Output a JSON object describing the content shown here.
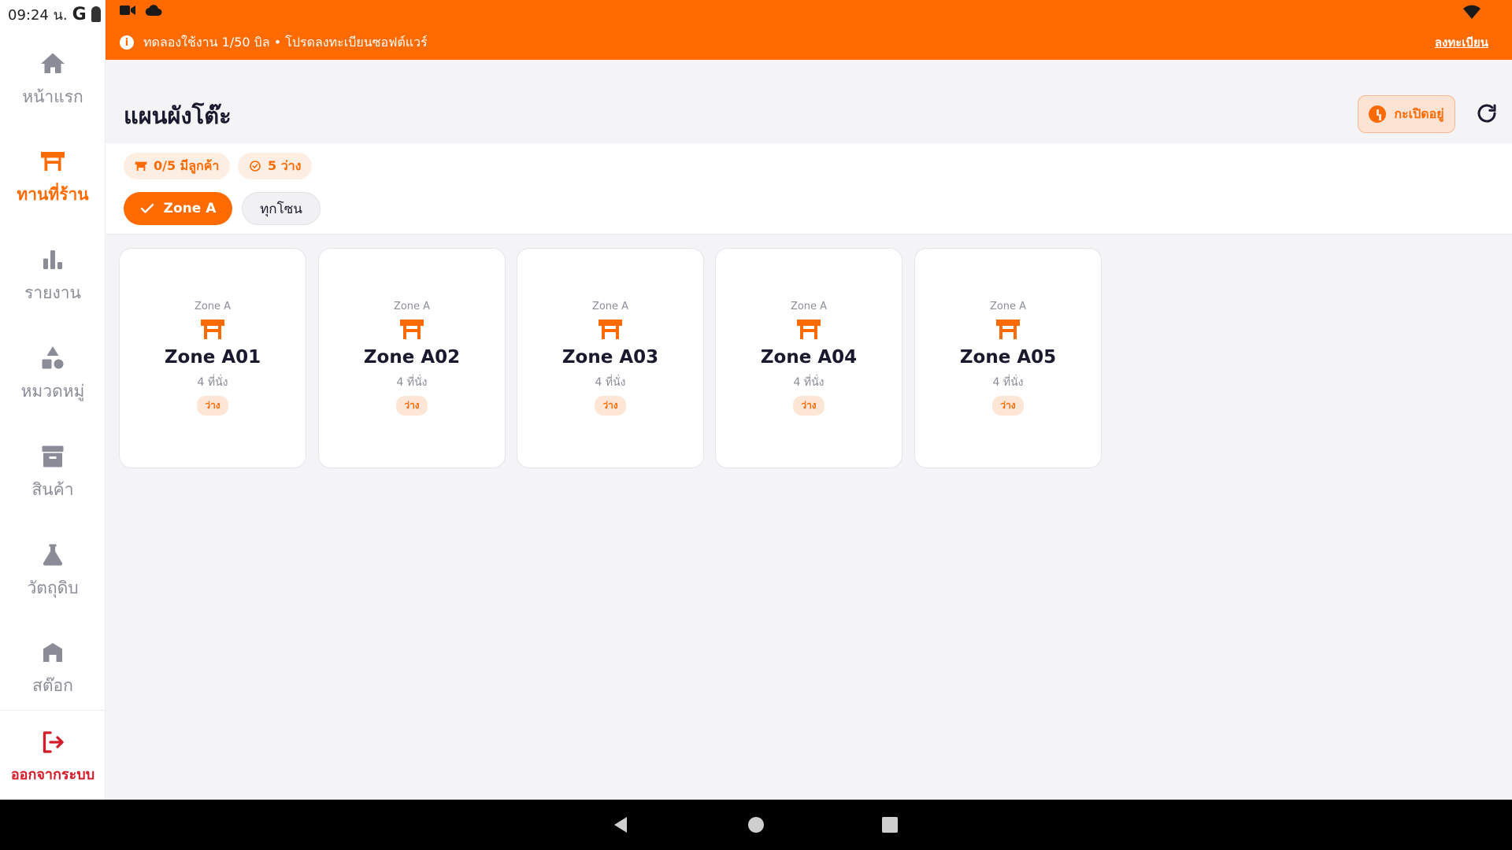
{
  "status_bar": {
    "time": "09:24 น.",
    "g_label": "G"
  },
  "banner": {
    "info_glyph": "i",
    "message": "ทดลองใช้งาน 1/50 บิล • โปรดลงทะเบียนซอฟต์แวร์",
    "register_label": "ลงทะเบียน"
  },
  "sidebar": {
    "items": [
      {
        "label": "หน้าแรก",
        "icon": "home-icon"
      },
      {
        "label": "ทานที่ร้าน",
        "icon": "table-icon"
      },
      {
        "label": "รายงาน",
        "icon": "bar-chart-icon"
      },
      {
        "label": "หมวดหมู่",
        "icon": "category-shapes-icon"
      },
      {
        "label": "สินค้า",
        "icon": "archive-icon"
      },
      {
        "label": "วัตถุดิบ",
        "icon": "flask-icon"
      },
      {
        "label": "สต๊อก",
        "icon": "warehouse-icon"
      }
    ],
    "logout_label": "ออกจากระบบ"
  },
  "header": {
    "title": "แผนผังโต๊ะ",
    "open_status": "กะเปิดอยู่"
  },
  "stats": {
    "occupied": "0/5 มีลูกค้า",
    "available": "5 ว่าง"
  },
  "zone_filters": {
    "selected": "Zone A",
    "all": "ทุกโซน"
  },
  "tables": [
    {
      "zone": "Zone A",
      "name": "Zone A01",
      "seats": "4 ที่นั่ง",
      "status": "ว่าง"
    },
    {
      "zone": "Zone A",
      "name": "Zone A02",
      "seats": "4 ที่นั่ง",
      "status": "ว่าง"
    },
    {
      "zone": "Zone A",
      "name": "Zone A03",
      "seats": "4 ที่นั่ง",
      "status": "ว่าง"
    },
    {
      "zone": "Zone A",
      "name": "Zone A04",
      "seats": "4 ที่นั่ง",
      "status": "ว่าง"
    },
    {
      "zone": "Zone A",
      "name": "Zone A05",
      "seats": "4 ที่นั่ง",
      "status": "ว่าง"
    }
  ],
  "colors": {
    "accent": "#ff6b00",
    "logout": "#d41c2a",
    "muted": "#8a8d97"
  }
}
